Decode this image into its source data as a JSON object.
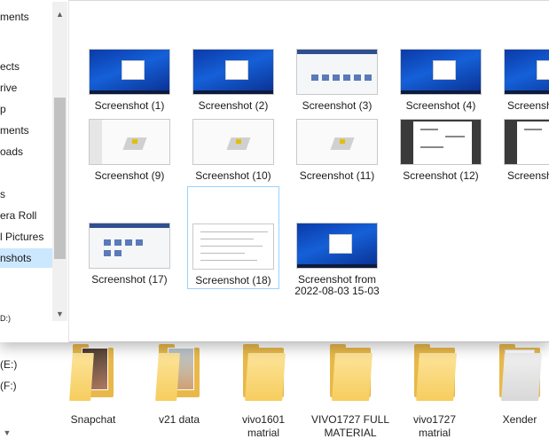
{
  "navigation": {
    "items": [
      {
        "label": "ments",
        "selected": false
      },
      {
        "label": "ects",
        "selected": false
      },
      {
        "label": "rive",
        "selected": false
      },
      {
        "label": "p",
        "selected": false
      },
      {
        "label": "ments",
        "selected": false
      },
      {
        "label": "oads",
        "selected": false
      },
      {
        "label": "s",
        "selected": false
      },
      {
        "label": "era Roll",
        "selected": false
      },
      {
        "label": "l Pictures",
        "selected": false
      },
      {
        "label": "nshots",
        "selected": true
      },
      {
        "label": "D:)",
        "selected": false
      }
    ]
  },
  "files": [
    {
      "name": "Screenshot (1)",
      "thumb": "blue-desktop"
    },
    {
      "name": "Screenshot (2)",
      "thumb": "blue-desktop"
    },
    {
      "name": "Screenshot (3)",
      "thumb": "app-window"
    },
    {
      "name": "Screenshot (4)",
      "thumb": "blue-desktop"
    },
    {
      "name": "Screensh",
      "thumb": "blue-desktop"
    },
    {
      "name": "Screenshot (9)",
      "thumb": "3d-editor"
    },
    {
      "name": "Screenshot (10)",
      "thumb": "3d-editor"
    },
    {
      "name": "Screenshot (11)",
      "thumb": "3d-editor"
    },
    {
      "name": "Screenshot (12)",
      "thumb": "dark-document"
    },
    {
      "name": "Screensh",
      "thumb": "dark-document"
    },
    {
      "name": "Screenshot (17)",
      "thumb": "app-window"
    },
    {
      "name": "Screenshot (18)",
      "thumb": "document",
      "selected": true
    },
    {
      "name": "Screenshot from\n2022-08-03 15-03",
      "thumb": "blue-desktop"
    }
  ],
  "background": {
    "drives": [
      "(E:)",
      "(F:)"
    ],
    "folders": [
      {
        "name": "Snapchat",
        "type": "photo-folder"
      },
      {
        "name": "v21 data",
        "type": "photo-folder"
      },
      {
        "name": "vivo1601\nmatrial",
        "type": "folder"
      },
      {
        "name": "VIVO1727 FULL\nMATERIAL",
        "type": "folder"
      },
      {
        "name": "vivo1727\nmatrial",
        "type": "folder"
      },
      {
        "name": "Xender",
        "type": "paper-folder"
      }
    ]
  },
  "icons": {
    "scroll_up": "chevron-up-icon",
    "scroll_down": "chevron-down-icon"
  },
  "colors": {
    "selection": "#cce8ff",
    "selected_border": "#99d1ff",
    "folder": "#f6cd5e"
  }
}
